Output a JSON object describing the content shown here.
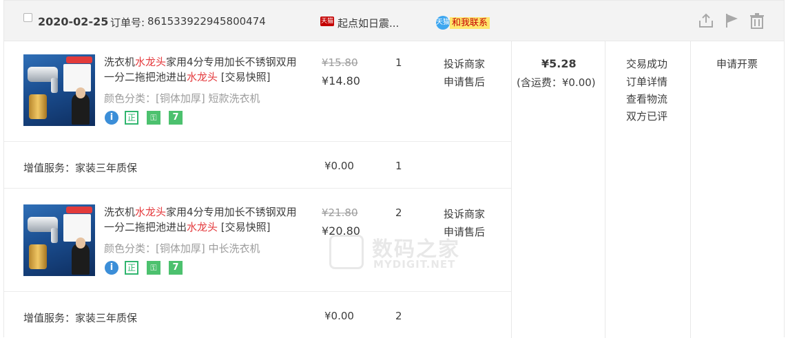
{
  "header": {
    "date": "2020-02-25",
    "order_no_label": "订单号:",
    "order_no": "861533922945800474",
    "tmall_badge": "天猫",
    "shop_name": "起点如日震...",
    "contact_bubble": "天猫",
    "contact_label": "和我联系",
    "icons": [
      "share-icon",
      "flag-icon",
      "trash-icon"
    ]
  },
  "items": [
    {
      "title_parts": [
        "洗衣机",
        "水龙头",
        "家用4分专用加长不锈钢双用一分二拖把池进出",
        "水龙头",
        " [交易快照]"
      ],
      "sku": "颜色分类：[铜体加厚] 短款洗衣机",
      "old_price": "¥15.80",
      "price": "¥14.80",
      "qty": "1",
      "links": [
        "投诉商家",
        "申请售后"
      ],
      "badges": [
        "i",
        "正",
        "⚿",
        "7"
      ]
    },
    {
      "title_parts": [
        "洗衣机",
        "水龙头",
        "家用4分专用加长不锈钢双用一分二拖把池进出",
        "水龙头",
        " [交易快照]"
      ],
      "sku": "颜色分类：[铜体加厚] 中长洗衣机",
      "old_price": "¥21.80",
      "price": "¥20.80",
      "qty": "2",
      "links": [
        "投诉商家",
        "申请售后"
      ],
      "badges": [
        "i",
        "正",
        "⚿",
        "7"
      ]
    }
  ],
  "services": [
    {
      "label": "增值服务：家装三年质保",
      "price": "¥0.00",
      "qty": "1"
    },
    {
      "label": "增值服务：家装三年质保",
      "price": "¥0.00",
      "qty": "2"
    }
  ],
  "summary": {
    "total": "¥5.28",
    "shipping": "(含运费：¥0.00)"
  },
  "status": [
    "交易成功",
    "订单详情",
    "查看物流",
    "双方已评"
  ],
  "invoice": "申请开票",
  "watermark": {
    "cn": "数码之家",
    "en": "MYDIGIT.NET"
  },
  "colors": {
    "highlight": "#e4393c",
    "header_bg": "#f3f3f3",
    "contact_bg": "#ffe66c"
  }
}
